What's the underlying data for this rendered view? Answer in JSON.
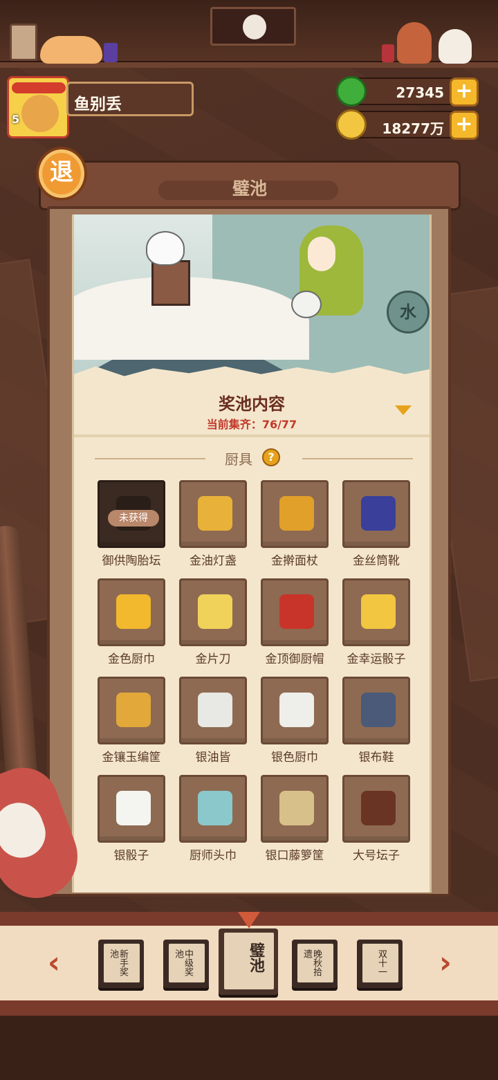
{
  "player": {
    "name": "鱼别丢",
    "level": "5"
  },
  "currency": {
    "jade": {
      "value": "27345",
      "plus_label": "+"
    },
    "coin": {
      "value": "18277万",
      "plus_label": "+"
    }
  },
  "exit_label": "退",
  "page_title": "璧池",
  "art": {
    "sign_text": "水"
  },
  "pool": {
    "title": "奖池内容",
    "progress_label": "当前集齐：",
    "progress_value": "76/77"
  },
  "category": {
    "name": "厨具",
    "help_label": "?"
  },
  "items": [
    {
      "name": "御供陶胎坛",
      "locked": true,
      "tag": "未获得",
      "icon_color": "#2a1e18"
    },
    {
      "name": "金油灯盏",
      "icon_color": "#e8b23a"
    },
    {
      "name": "金擀面杖",
      "icon_color": "#e0a02a"
    },
    {
      "name": "金丝筒靴",
      "icon_color": "#3a3f9a"
    },
    {
      "name": "金色厨巾",
      "icon_color": "#f2b82e"
    },
    {
      "name": "金片刀",
      "icon_color": "#f0d25a"
    },
    {
      "name": "金顶御厨帽",
      "icon_color": "#c8342a"
    },
    {
      "name": "金幸运骰子",
      "icon_color": "#f2c640"
    },
    {
      "name": "金镶玉编筐",
      "icon_color": "#e2a83a"
    },
    {
      "name": "银油皆",
      "icon_color": "#e8e8e4"
    },
    {
      "name": "银色厨巾",
      "icon_color": "#eeeeea"
    },
    {
      "name": "银布鞋",
      "icon_color": "#4a5a78"
    },
    {
      "name": "银骰子",
      "icon_color": "#f4f4f0"
    },
    {
      "name": "厨师头巾",
      "icon_color": "#8ac8cc"
    },
    {
      "name": "银口藤箩筐",
      "icon_color": "#d8c08a"
    },
    {
      "name": "大号坛子",
      "icon_color": "#6a3424"
    }
  ],
  "tabs": [
    {
      "label": "新手奖池"
    },
    {
      "label": "中级奖池"
    },
    {
      "label": "璧池",
      "active": true
    },
    {
      "label": "晚秋拾遗"
    },
    {
      "label": "双十一"
    }
  ],
  "nav": {
    "prev": "‹",
    "next": "›"
  },
  "colors": {
    "accent": "#f5b82a",
    "progress": "#c0392b",
    "title": "#6a2e20"
  }
}
